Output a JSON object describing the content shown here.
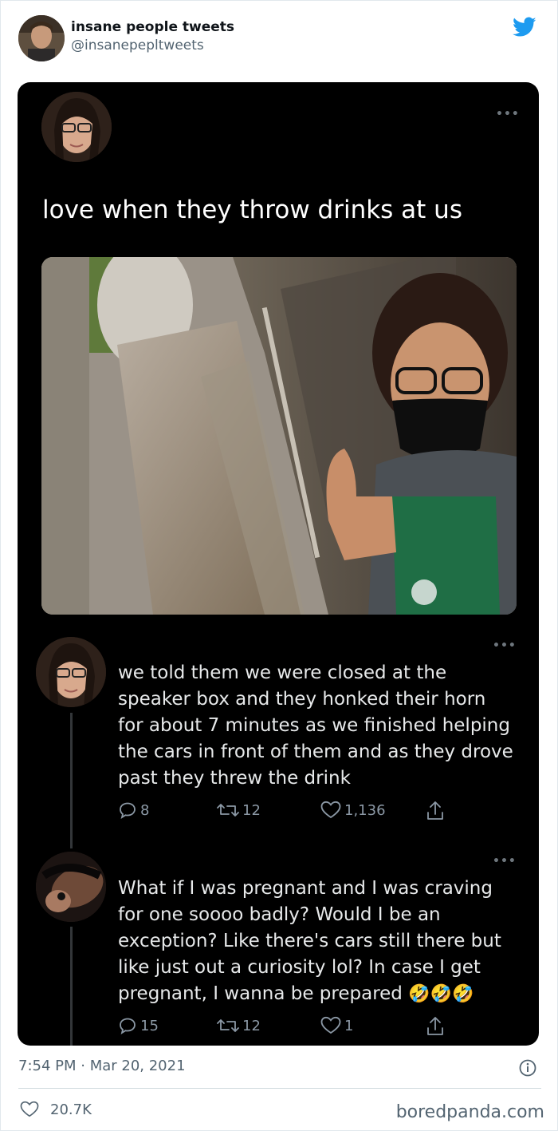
{
  "account": {
    "display_name": "insane people tweets",
    "handle": "@insanepepltweets",
    "avatar_icon": "profile-photo",
    "brand_icon": "twitter-bird-icon",
    "brand_color": "#1d9bf0"
  },
  "screenshot": {
    "original_post": {
      "avatar_icon": "profile-photo",
      "text": "love when they throw drinks at us",
      "image_icon": "selfie-photo"
    },
    "replies": [
      {
        "avatar_icon": "profile-photo",
        "text": "we told them we were closed at the speaker box and they honked their horn for about 7 minutes as we finished helping the cars in front of them and as they drove past they threw the drink",
        "replies_count": "8",
        "retweets_count": "12",
        "likes_count": "1,136"
      },
      {
        "avatar_icon": "profile-photo",
        "text": "What if I was pregnant and I was craving for one soooo badly? Would I be an exception? Like there's cars still there but like just out a curiosity lol? In case I get pregnant, I wanna be prepared",
        "emoji": "🤣🤣🤣",
        "replies_count": "15",
        "retweets_count": "12",
        "likes_count": "1"
      }
    ]
  },
  "footer": {
    "timestamp": "7:54 PM · Mar 20, 2021",
    "likes": "20.7K",
    "watermark": "boredpanda.com"
  }
}
